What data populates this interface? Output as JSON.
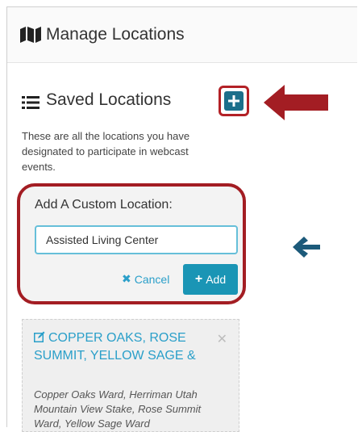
{
  "header": {
    "title": "Manage Locations",
    "icon": "map-icon"
  },
  "saved": {
    "title": "Saved Locations",
    "icon": "list-icon",
    "description": "These are all the locations you have designated to participate in webcast events.",
    "add_icon": "plus-square-icon"
  },
  "custom_location": {
    "label": "Add A Custom Location:",
    "input_value": "Assisted Living Center",
    "cancel_label": "Cancel",
    "add_label": "Add"
  },
  "locations": [
    {
      "title": "COPPER OAKS, ROSE SUMMIT, YELLOW SAGE &",
      "description": "Copper Oaks Ward, Herriman Utah Mountain View Stake, Rose Summit Ward, Yellow Sage Ward"
    }
  ],
  "colors": {
    "highlight_red": "#a31d23",
    "primary_blue": "#1a95b5",
    "link_blue": "#2a9fc9",
    "dark_blue": "#1c6f8b"
  }
}
